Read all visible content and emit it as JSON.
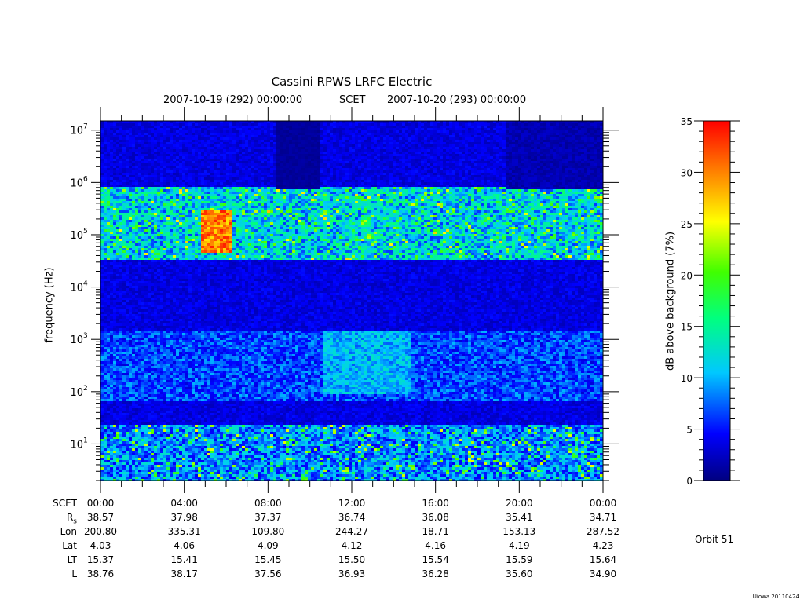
{
  "chart_data": {
    "type": "heatmap",
    "title": "Cassini RPWS LRFC Electric",
    "subtitle_start": "2007-10-19 (292) 00:00:00",
    "subtitle_scet": "SCET",
    "subtitle_end": "2007-10-20 (293) 00:00:00",
    "ylabel": "frequency (Hz)",
    "yscale": "log",
    "ylim": [
      2,
      15000000
    ],
    "y_ticks": [
      10,
      100,
      1000,
      10000,
      100000,
      1000000,
      10000000
    ],
    "y_tick_labels": [
      {
        "base": "10",
        "exp": "1"
      },
      {
        "base": "10",
        "exp": "2"
      },
      {
        "base": "10",
        "exp": "3"
      },
      {
        "base": "10",
        "exp": "4"
      },
      {
        "base": "10",
        "exp": "5"
      },
      {
        "base": "10",
        "exp": "6"
      },
      {
        "base": "10",
        "exp": "7"
      }
    ],
    "x_ticks": [
      "00:00",
      "04:00",
      "08:00",
      "12:00",
      "16:00",
      "20:00",
      "00:00"
    ],
    "x_range_hours": [
      0,
      24
    ],
    "colorbar": {
      "label": "dB above background (7%)",
      "range": [
        0,
        35
      ],
      "ticks": [
        0,
        5,
        10,
        15,
        20,
        25,
        30,
        35
      ]
    },
    "ephemeris": {
      "header_label": "SCET",
      "rows": [
        {
          "label": "R",
          "sub": "s",
          "values": [
            "38.57",
            "37.98",
            "37.37",
            "36.74",
            "36.08",
            "35.41",
            "34.71"
          ]
        },
        {
          "label": "Lon",
          "sub": "",
          "values": [
            "200.80",
            "335.31",
            "109.80",
            "244.27",
            "18.71",
            "153.13",
            "287.52"
          ]
        },
        {
          "label": "Lat",
          "sub": "",
          "values": [
            "4.03",
            "4.06",
            "4.09",
            "4.12",
            "4.16",
            "4.19",
            "4.23"
          ]
        },
        {
          "label": "LT",
          "sub": "",
          "values": [
            "15.37",
            "15.41",
            "15.45",
            "15.50",
            "15.54",
            "15.59",
            "15.64"
          ]
        },
        {
          "label": "L",
          "sub": "",
          "values": [
            "38.76",
            "38.17",
            "37.56",
            "36.93",
            "36.28",
            "35.60",
            "34.90"
          ]
        }
      ]
    },
    "annotations": {
      "orbit": "Orbit 51",
      "version": "Uiowa 20110424"
    }
  }
}
